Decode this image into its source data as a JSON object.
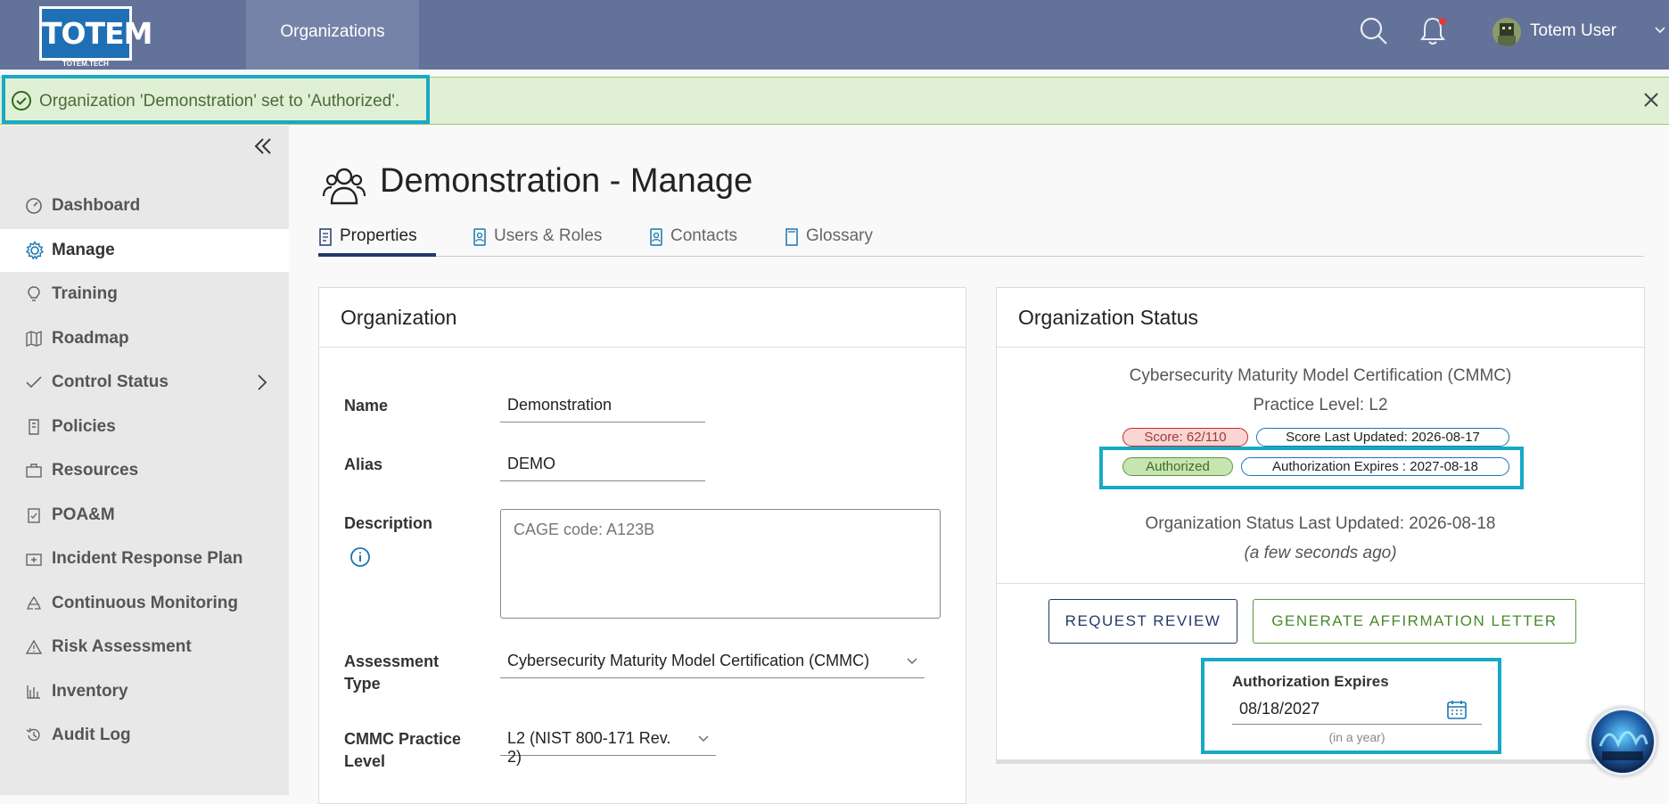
{
  "topbar": {
    "logo_text": "TOTEM",
    "logo_sub": "TOTEM.TECH",
    "nav_organizations": "Organizations",
    "user_name": "Totem User"
  },
  "alert": {
    "message": "Organization 'Demonstration' set to 'Authorized'."
  },
  "sidebar": {
    "items": [
      {
        "label": "Dashboard",
        "icon": "dashboard-icon"
      },
      {
        "label": "Manage",
        "icon": "gear-icon"
      },
      {
        "label": "Training",
        "icon": "lightbulb-icon"
      },
      {
        "label": "Roadmap",
        "icon": "map-icon"
      },
      {
        "label": "Control Status",
        "icon": "check-icon"
      },
      {
        "label": "Policies",
        "icon": "scroll-icon"
      },
      {
        "label": "Resources",
        "icon": "briefcase-icon"
      },
      {
        "label": "POA&M",
        "icon": "clipboard-icon"
      },
      {
        "label": "Incident Response Plan",
        "icon": "first-aid-icon"
      },
      {
        "label": "Continuous Monitoring",
        "icon": "recycle-icon"
      },
      {
        "label": "Risk Assessment",
        "icon": "warning-icon"
      },
      {
        "label": "Inventory",
        "icon": "inventory-icon"
      },
      {
        "label": "Audit Log",
        "icon": "history-icon"
      }
    ]
  },
  "page": {
    "title": "Demonstration - Manage",
    "tabs": [
      {
        "label": "Properties"
      },
      {
        "label": "Users & Roles"
      },
      {
        "label": "Contacts"
      },
      {
        "label": "Glossary"
      }
    ]
  },
  "org_card": {
    "title": "Organization",
    "name_label": "Name",
    "name_value": "Demonstration",
    "alias_label": "Alias",
    "alias_value": "DEMO",
    "description_label": "Description",
    "description_value": "CAGE code: A123B",
    "assessment_label_1": "Assessment",
    "assessment_label_2": "Type",
    "assessment_value": "Cybersecurity Maturity Model Certification (CMMC)",
    "level_label_1": "CMMC Practice",
    "level_label_2": "Level",
    "level_value": "L2 (NIST 800-171 Rev. 2)"
  },
  "status_card": {
    "title": "Organization Status",
    "framework": "Cybersecurity Maturity Model Certification (CMMC)",
    "practice_level": "Practice Level: L2",
    "score": "Score: 62/110",
    "score_updated": "Score Last Updated: 2026-08-17",
    "auth_status": "Authorized",
    "auth_expires_pill": "Authorization Expires : 2027-08-18",
    "status_updated": "Organization Status Last Updated: 2026-08-18",
    "status_updated_relative": "(a few seconds ago)",
    "request_review": "REQUEST REVIEW",
    "generate_letter": "GENERATE AFFIRMATION LETTER",
    "expires_label": "Authorization Expires",
    "expires_value": "08/18/2027",
    "expires_hint": "(in a year)"
  },
  "colors": {
    "topbar": "#637299",
    "highlight": "#18a9c6",
    "alert_bg": "#e0f0d4",
    "nav_blue": "#223a69",
    "success_green": "#5a9a3a"
  }
}
